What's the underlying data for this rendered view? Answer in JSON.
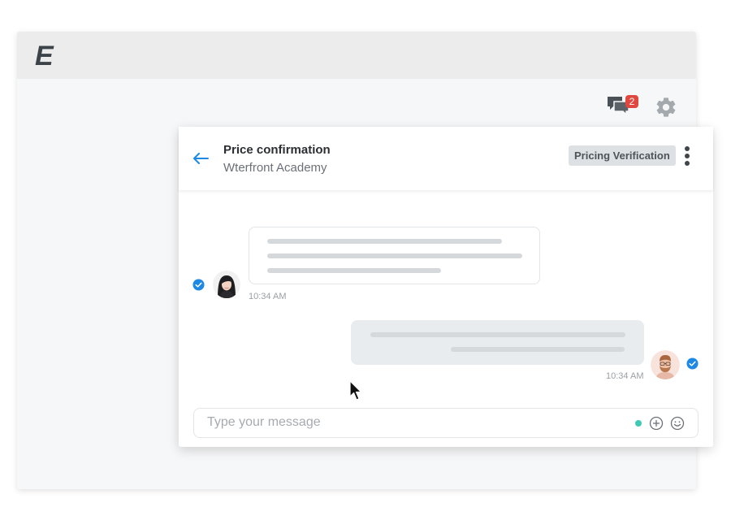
{
  "app": {
    "logo_text": "E",
    "notification_count": "2",
    "icons": [
      "chat-bubbles-icon",
      "gear-icon",
      "back-arrow-icon",
      "kebab-menu-icon",
      "check-circle-icon",
      "plus-circle-icon",
      "smile-icon",
      "cursor-icon"
    ]
  },
  "chat": {
    "title": "Price confirmation",
    "subtitle": "Wterfront Academy",
    "tag": "Pricing Verification",
    "messages": [
      {
        "direction": "incoming",
        "time": "10:34 AM",
        "read": true
      },
      {
        "direction": "outgoing",
        "time": "10:34 AM",
        "read": true
      }
    ],
    "composer": {
      "placeholder": "Type your message",
      "value": ""
    }
  },
  "colors": {
    "accent_blue": "#1e88e5",
    "badge_red": "#e0473e",
    "online_dot": "#3ec9b4",
    "tag_bg": "#dde1e3"
  }
}
